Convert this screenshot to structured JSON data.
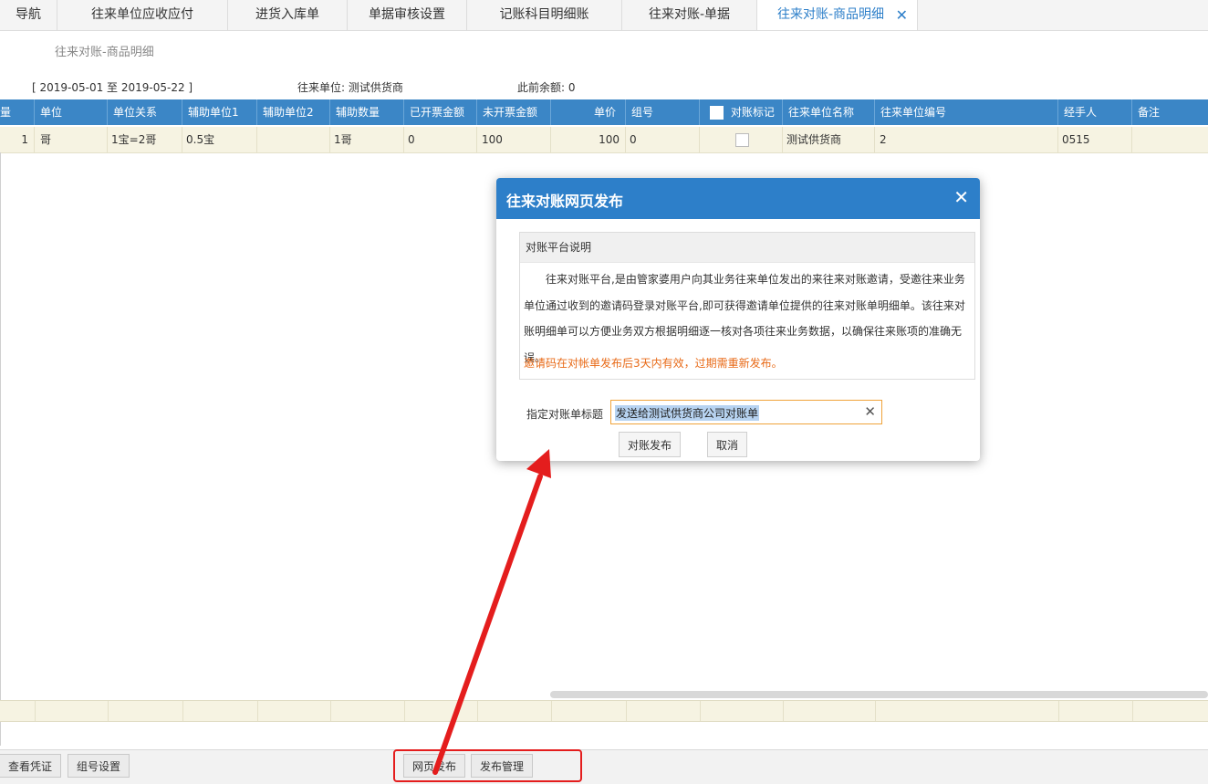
{
  "tabs": [
    {
      "label": "导航"
    },
    {
      "label": "往来单位应收应付"
    },
    {
      "label": "进货入库单"
    },
    {
      "label": "单据审核设置"
    },
    {
      "label": "记账科目明细账"
    },
    {
      "label": "往来对账-单据"
    },
    {
      "label": "往来对账-商品明细",
      "active": true
    }
  ],
  "page": {
    "title": "往来对账-商品明细",
    "date_range": "[  2019-05-01  至  2019-05-22  ]",
    "partner": "往来单位:  测试供货商",
    "prior_balance": "此前余额:  0"
  },
  "grid": {
    "columns": [
      "量",
      "单位",
      "单位关系",
      "辅助单位1",
      "辅助单位2",
      "辅助数量",
      "已开票金额",
      "未开票金额",
      "单价",
      "组号",
      "对账标记",
      "往来单位名称",
      "往来单位编号",
      "经手人",
      "备注"
    ],
    "rows": [
      {
        "qty": "1",
        "unit": "哥",
        "relation": "1宝=2哥",
        "aux1": "0.5宝",
        "aux2": "",
        "aux_qty": "1哥",
        "invoiced": "0",
        "uninvoiced": "100",
        "price": "100",
        "group": "0",
        "checked": false,
        "partner_name": "测试供货商",
        "partner_code": "2",
        "handler": "0515",
        "remark": ""
      }
    ]
  },
  "bottom_buttons": {
    "view_voucher": "查看凭证",
    "group_settings": "组号设置",
    "web_publish": "网页发布",
    "publish_manage": "发布管理"
  },
  "dialog": {
    "title": "往来对账网页发布",
    "panel_title": "对账平台说明",
    "description": "往来对账平台,是由管家婆用户向其业务往来单位发出的来往来对账邀请，受邀往来业务单位通过收到的邀请码登录对账平台,即可获得邀请单位提供的往来对账单明细单。该往来对账明细单可以方便业务双方根据明细逐一核对各项往来业务数据，以确保往来账项的准确无误。",
    "warning": "邀请码在对帐单发布后3天内有效，过期需重新发布。",
    "field_label": "指定对账单标题",
    "field_value": "发送给测试供货商公司对账单",
    "confirm_label": "对账发布",
    "cancel_label": "取消"
  },
  "colors": {
    "header_blue": "#3b86c6",
    "dialog_blue": "#2d7fc9",
    "warning_orange": "#e86a17",
    "annotation_red": "#e41d1d"
  }
}
